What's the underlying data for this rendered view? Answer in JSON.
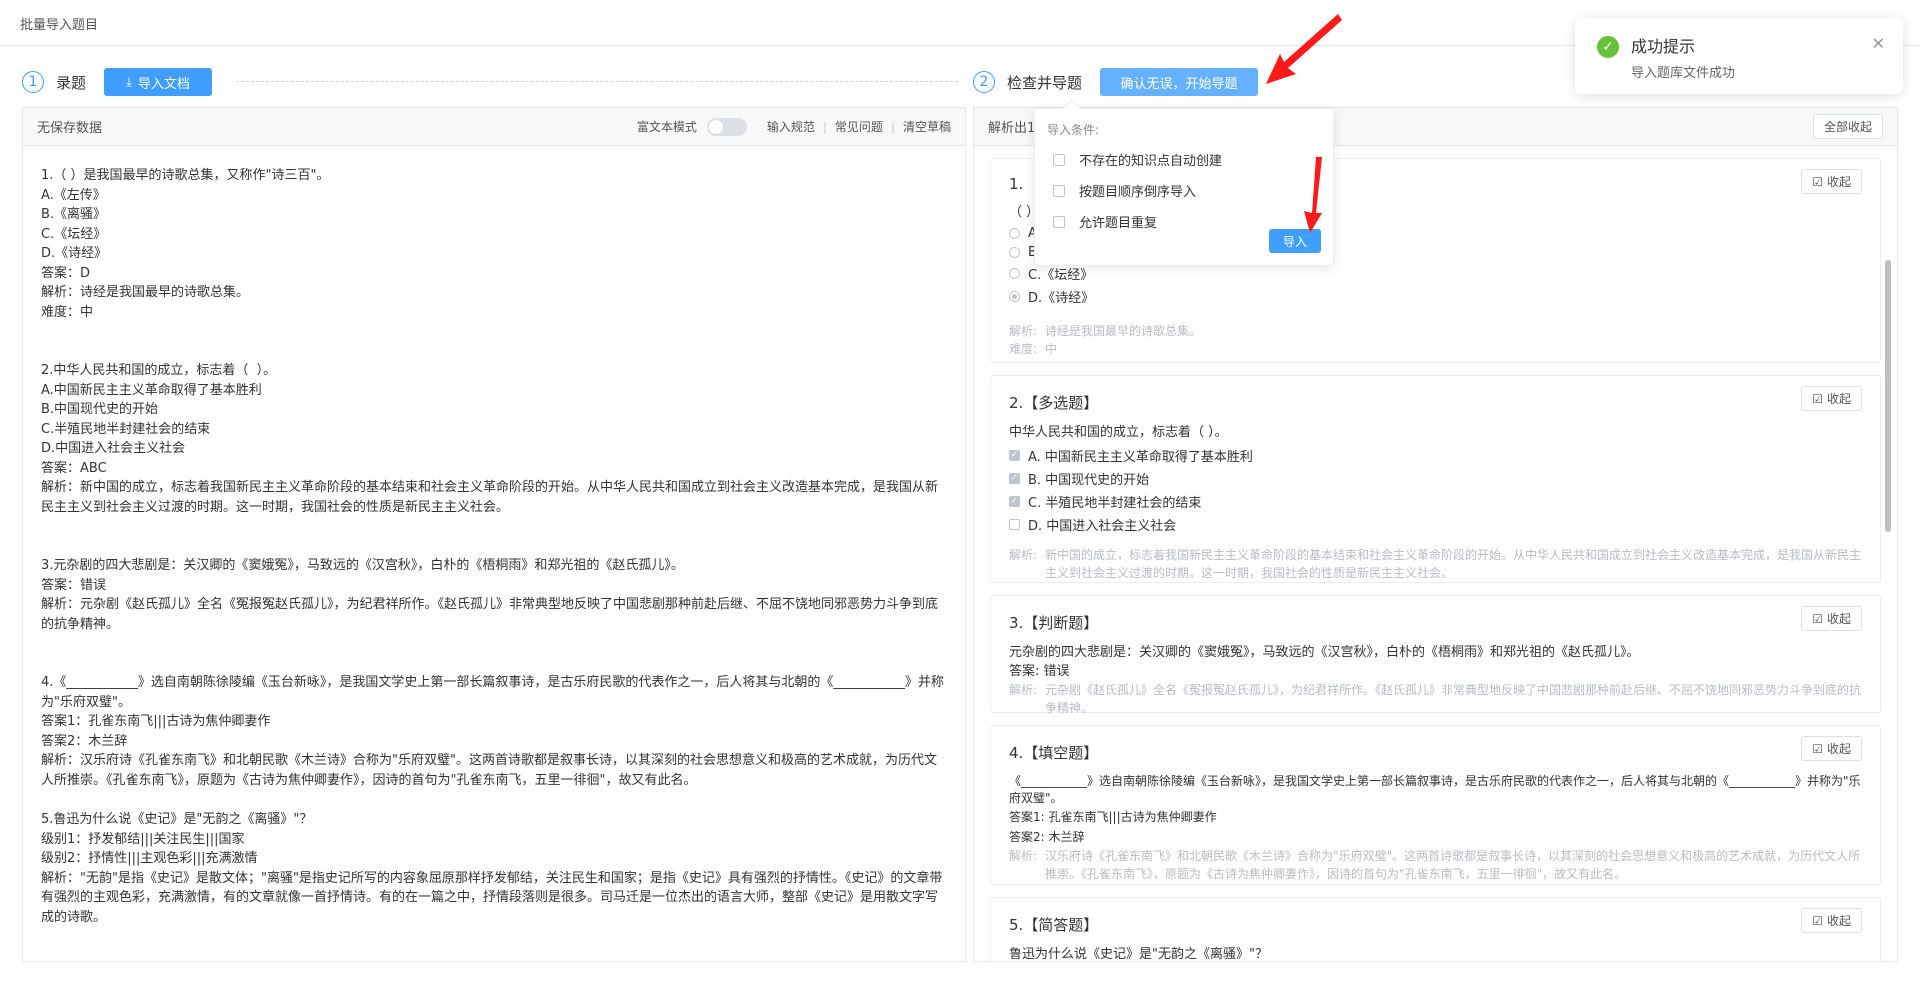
{
  "page": {
    "title": "批量导入题目"
  },
  "steps": [
    {
      "num": "1",
      "label": "录题",
      "button": "导入文档"
    },
    {
      "num": "2",
      "label": "检查并导题",
      "button": "确认无误，开始导题"
    }
  ],
  "left_panel": {
    "header": "无保存数据",
    "rich_text_label": "富文本模式",
    "links": [
      "输入规范",
      "常见问题",
      "清空草稿"
    ],
    "blocks": [
      [
        "1.（ ）是我国最早的诗歌总集，又称作\"诗三百\"。",
        "A.《左传》",
        "B.《离骚》",
        "C.《坛经》",
        "D.《诗经》",
        "答案：D",
        "解析：诗经是我国最早的诗歌总集。",
        "难度：中"
      ],
      [
        "2.中华人民共和国的成立，标志着（  ）。",
        "A.中国新民主主义革命取得了基本胜利",
        "B.中国现代史的开始",
        "C.半殖民地半封建社会的结束",
        "D.中国进入社会主义社会",
        "答案：ABC",
        "解析：新中国的成立，标志着我国新民主主义革命阶段的基本结束和社会主义革命阶段的开始。从中华人民共和国成立到社会主义改造基本完成，是我国从新民主主义到社会主义过渡的时期。这一时期，我国社会的性质是新民主主义社会。"
      ],
      [
        "3.元杂剧的四大悲剧是：关汉卿的《窦娥冤》，马致远的《汉宫秋》，白朴的《梧桐雨》和郑光祖的《赵氏孤儿》。",
        "答案：错误",
        "解析：元杂剧《赵氏孤儿》全名《冤报冤赵氏孤儿》，为纪君祥所作。《赵氏孤儿》非常典型地反映了中国悲剧那种前赴后继、不屈不饶地同邪恶势力斗争到底的抗争精神。"
      ],
      [
        "4.《___________》选自南朝陈徐陵编《玉台新咏》，是我国文学史上第一部长篇叙事诗，是古乐府民歌的代表作之一，后人将其与北朝的《___________》并称为\"乐府双璧\"。",
        "答案1：孔雀东南飞|||古诗为焦仲卿妻作",
        "答案2：木兰辞",
        "解析：汉乐府诗《孔雀东南飞》和北朝民歌《木兰诗》合称为\"乐府双璧\"。这两首诗歌都是叙事长诗，以其深刻的社会思想意义和极高的艺术成就，为历代文人所推崇。《孔雀东南飞》，原题为《古诗为焦仲卿妻作》，因诗的首句为\"孔雀东南飞，五里一徘徊\"，故又有此名。"
      ],
      [
        "5.鲁迅为什么说《史记》是\"无韵之《离骚》\"？",
        "级别1：抒发郁结|||关注民生|||国家",
        "级别2：抒情性|||主观色彩|||充满激情",
        "解析：\"无韵\"是指《史记》是散文体；\"离骚\"是指史记所写的内容象屈原那样抒发郁结，关注民生和国家；是指《史记》具有强烈的抒情性。《史记》的文章带有强烈的主观色彩，充满激情，有的文章就像一首抒情诗。有的在一篇之中，抒情段落则是很多。司马迁是一位杰出的语言大师，整部《史记》是用散文字写成的诗歌。"
      ]
    ]
  },
  "right_panel": {
    "header_prefix": "解析出1",
    "collapse_all": "全部收起",
    "collapse": "收起",
    "q1": {
      "num": "1.",
      "stem": "（ ）",
      "options": [
        "A.",
        "B.",
        "C.《坛经》",
        "D.《诗经》"
      ],
      "analysis_key": "解析:",
      "analysis": "诗经是我国最早的诗歌总集。",
      "difficulty_key": "难度:",
      "difficulty": "中"
    },
    "q2": {
      "title": "2.【多选题】",
      "stem": "中华人民共和国的成立，标志着（  ）。",
      "options": [
        "A. 中国新民主主义革命取得了基本胜利",
        "B. 中国现代史的开始",
        "C. 半殖民地半封建社会的结束",
        "D. 中国进入社会主义社会"
      ],
      "analysis_key": "解析:",
      "analysis": "新中国的成立，标志着我国新民主主义革命阶段的基本结束和社会主义革命阶段的开始。从中华人民共和国成立到社会主义改造基本完成，是我国从新民主主义到社会主义过渡的时期。这一时期，我国社会的性质是新民主主义社会。"
    },
    "q3": {
      "title": "3.【判断题】",
      "stem": "元杂剧的四大悲剧是：关汉卿的《窦娥冤》，马致远的《汉宫秋》，白朴的《梧桐雨》和郑光祖的《赵氏孤儿》。",
      "answer": "答案:  错误",
      "analysis_key": "解析:",
      "analysis": "元杂剧《赵氏孤儿》全名《冤报冤赵氏孤儿》，为纪君祥所作。《赵氏孤儿》非常典型地反映了中国悲剧那种前赴后继、不屈不饶地同邪恶势力斗争到底的抗争精神。"
    },
    "q4": {
      "title": "4.【填空题】",
      "stem": "《___________》选自南朝陈徐陵编《玉台新咏》，是我国文学史上第一部长篇叙事诗，是古乐府民歌的代表作之一，后人将其与北朝的《___________》并称为\"乐府双璧\"。",
      "answer1": "答案1: 孔雀东南飞|||古诗为焦仲卿妻作",
      "answer2": "答案2: 木兰辞",
      "analysis_key": "解析:",
      "analysis": "汉乐府诗《孔雀东南飞》和北朝民歌《木兰诗》合称为\"乐府双璧\"。这两首诗歌都是叙事长诗，以其深刻的社会思想意义和极高的艺术成就，为历代文人所推崇。《孔雀东南飞》，原题为《古诗为焦仲卿妻作》，因诗的首句为\"孔雀东南飞，五里一徘徊\"，故又有此名。"
    },
    "q5": {
      "title": "5.【简答题】",
      "stem": "鲁迅为什么说《史记》是\"无韵之《离骚》\"？"
    }
  },
  "popover": {
    "title": "导入条件:",
    "options": [
      "不存在的知识点自动创建",
      "按题目顺序倒序导入",
      "允许题目重复"
    ],
    "import_button": "导入"
  },
  "toast": {
    "title": "成功提示",
    "message": "导入题库文件成功"
  },
  "colors": {
    "primary": "#409eff",
    "success": "#67c23a",
    "annotation_arrow": "#ff1a1a"
  }
}
